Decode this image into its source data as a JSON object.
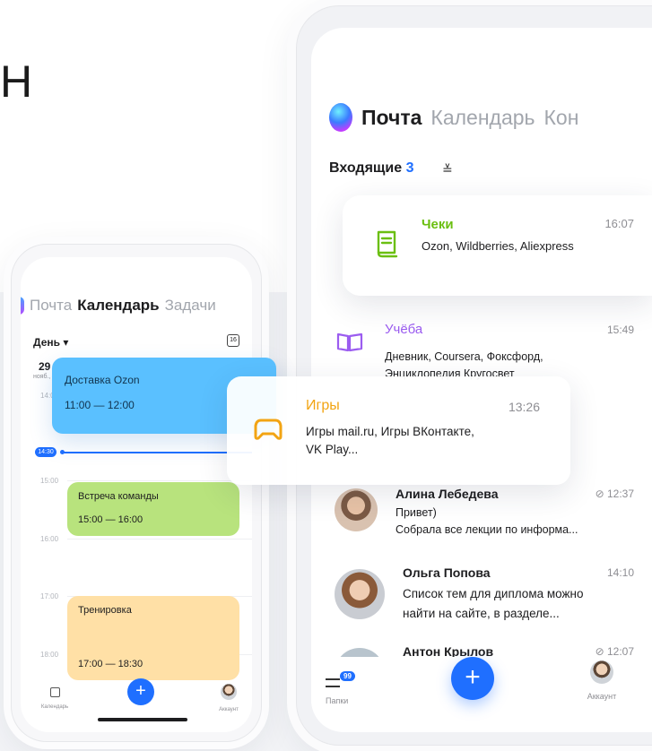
{
  "heading_fragment": "Н",
  "calendar_phone": {
    "tabs": [
      "Почта",
      "Календарь",
      "Задачи"
    ],
    "view": "День",
    "date_day": "29",
    "date_month": "нояб.,",
    "hours": [
      "14:00",
      "15:00",
      "16:00",
      "17:00",
      "18:00"
    ],
    "now": "14:30",
    "events": [
      {
        "title": "Доставка Ozon",
        "time": "11:00 — 12:00",
        "color": "#5ac0ff"
      },
      {
        "title": "Встреча команды",
        "time": "15:00 — 16:00",
        "color": "#b8e37d"
      },
      {
        "title": "Тренировка",
        "time": "17:00 — 18:30",
        "color": "#ffe0a6"
      }
    ],
    "nav": {
      "calendar": "Календарь",
      "account": "Аккаунт"
    }
  },
  "mail_phone": {
    "tabs": [
      "Почта",
      "Календарь",
      "Кон"
    ],
    "inbox_label": "Входящие",
    "inbox_count": "3",
    "groups": [
      {
        "title": "Чеки",
        "time": "16:07",
        "from": "Ozon, Wildberries, Aliexpress",
        "color": "#6bbf11"
      },
      {
        "title": "Учёба",
        "time": "15:49",
        "line1": "Дневник, Coursera, Фоксфорд,",
        "line2": "Энциклопедия Кругосвет",
        "color": "#9b5cf0"
      },
      {
        "title": "Игры",
        "time": "13:26",
        "line1": "Игры mail.ru, Игры ВКонтакте,",
        "line2": "VK Play...",
        "color": "#f2a413"
      }
    ],
    "messages": [
      {
        "from": "Алина Лебедева",
        "time": "12:37",
        "line1": "Привет)",
        "line2": "Собрала все лекции по информа..."
      },
      {
        "from": "Ольга Попова",
        "time": "14:10",
        "line1": "Список тем для диплома можно",
        "line2": "найти на сайте, в разделе..."
      },
      {
        "from": "Антон Крылов",
        "time": "12:07"
      }
    ],
    "nav": {
      "folders": "Папки",
      "folders_badge": "99",
      "account": "Аккаунт"
    }
  }
}
